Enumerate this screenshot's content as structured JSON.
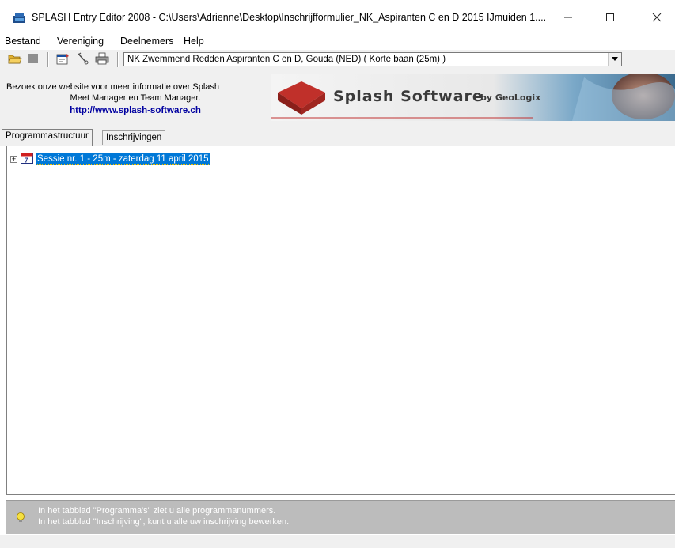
{
  "window": {
    "title": "SPLASH Entry Editor 2008 - C:\\Users\\Adrienne\\Desktop\\Inschrijfformulier_NK_Aspiranten C en D 2015 IJmuiden 1....",
    "minimize_icon": "minimize-icon",
    "maximize_icon": "maximize-icon",
    "close_icon": "close-icon"
  },
  "menu": {
    "items": [
      "Bestand",
      "Vereniging",
      "Deelnemers",
      "Help"
    ]
  },
  "toolbar": {
    "icons": [
      "open-folder-icon",
      "stop-icon",
      "properties-icon",
      "tools-icon",
      "printer-icon"
    ],
    "meet_select": "NK Zwemmend Redden Aspiranten C en D,  Gouda  (NED)   ( Korte baan (25m) )"
  },
  "banner": {
    "promo_line1": "Bezoek onze website voor meer informatie over Splash",
    "promo_line2": "Meet Manager en Team Manager.",
    "promo_url": "http://www.splash-software.ch",
    "logo_text": "Splash Software",
    "logo_by": "by GeoLogix",
    "brand_color": "#c0302a"
  },
  "tabs": [
    {
      "label": "Programmastructuur",
      "active": true
    },
    {
      "label": "Inschrijvingen",
      "active": false
    }
  ],
  "tree": {
    "session_label": "Sessie nr. 1 - 25m - zaterdag 11 april 2015",
    "expander": "+"
  },
  "status": {
    "hint_line1": "In het tabblad \"Programma's\" ziet u alle programmanummers.",
    "hint_line2": "In het tabblad \"Inschrijving\", kunt u alle uw inschrijving bewerken."
  }
}
